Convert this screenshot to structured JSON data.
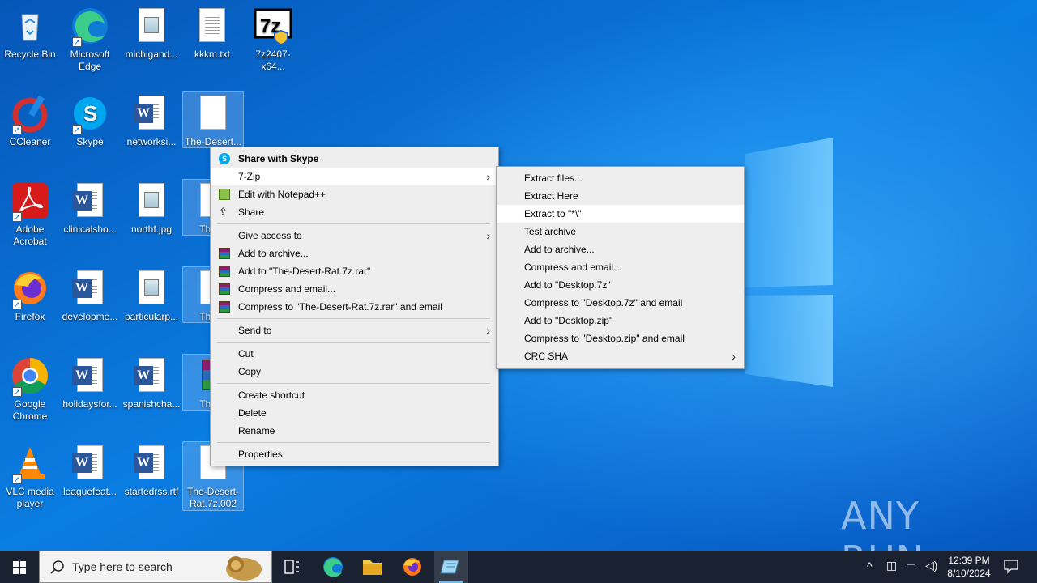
{
  "desktop": {
    "icons": {
      "recycle_bin": "Recycle Bin",
      "edge": "Microsoft Edge",
      "michigand": "michigand...",
      "kkkm": "kkkm.txt",
      "sevenzip_installer": "7z2407-x64...",
      "ccleaner": "CCleaner",
      "skype": "Skype",
      "networksi": "networksi...",
      "desert_1": "The-Desert...",
      "adobe": "Adobe Acrobat",
      "clinicalsho": "clinicalsho...",
      "northf": "northf.jpg",
      "desert_2": "The-D",
      "firefox": "Firefox",
      "developme": "developme...",
      "particularp": "particularp...",
      "desert_3": "The-D",
      "chrome": "Google Chrome",
      "holidaysfor": "holidaysfor...",
      "spanishcha": "spanishcha...",
      "desert_4": "The-D",
      "vlc": "VLC media player",
      "leaguefeat": "leaguefeat...",
      "startedrss": "startedrss.rtf",
      "desert_5": "The-Desert-Rat.7z.002"
    }
  },
  "context_menu": {
    "share_skype": "Share with Skype",
    "seven_zip": "7-Zip",
    "edit_notepad": "Edit with Notepad++",
    "share": "Share",
    "give_access": "Give access to",
    "add_archive": "Add to archive...",
    "add_rar": "Add to \"The-Desert-Rat.7z.rar\"",
    "compress_email": "Compress and email...",
    "compress_rar_email": "Compress to \"The-Desert-Rat.7z.rar\" and email",
    "send_to": "Send to",
    "cut": "Cut",
    "copy": "Copy",
    "create_shortcut": "Create shortcut",
    "delete": "Delete",
    "rename": "Rename",
    "properties": "Properties"
  },
  "submenu_7zip": {
    "extract_files": "Extract files...",
    "extract_here": "Extract Here",
    "extract_to": "Extract to \"*\\\"",
    "test_archive": "Test archive",
    "add_archive": "Add to archive...",
    "compress_email": "Compress and email...",
    "add_desktop_7z": "Add to \"Desktop.7z\"",
    "compress_desktop_7z_email": "Compress to \"Desktop.7z\" and email",
    "add_desktop_zip": "Add to \"Desktop.zip\"",
    "compress_desktop_zip_email": "Compress to \"Desktop.zip\" and email",
    "crc_sha": "CRC SHA"
  },
  "taskbar": {
    "search_placeholder": "Type here to search",
    "time": "12:39 PM",
    "date": "8/10/2024"
  },
  "watermark": "ANY RUN",
  "colors": {
    "taskbar": "#1a2232",
    "menu_bg": "#eeeeee",
    "menu_highlight": "#ffffff",
    "desktop_blue": "#0a7ae0"
  }
}
